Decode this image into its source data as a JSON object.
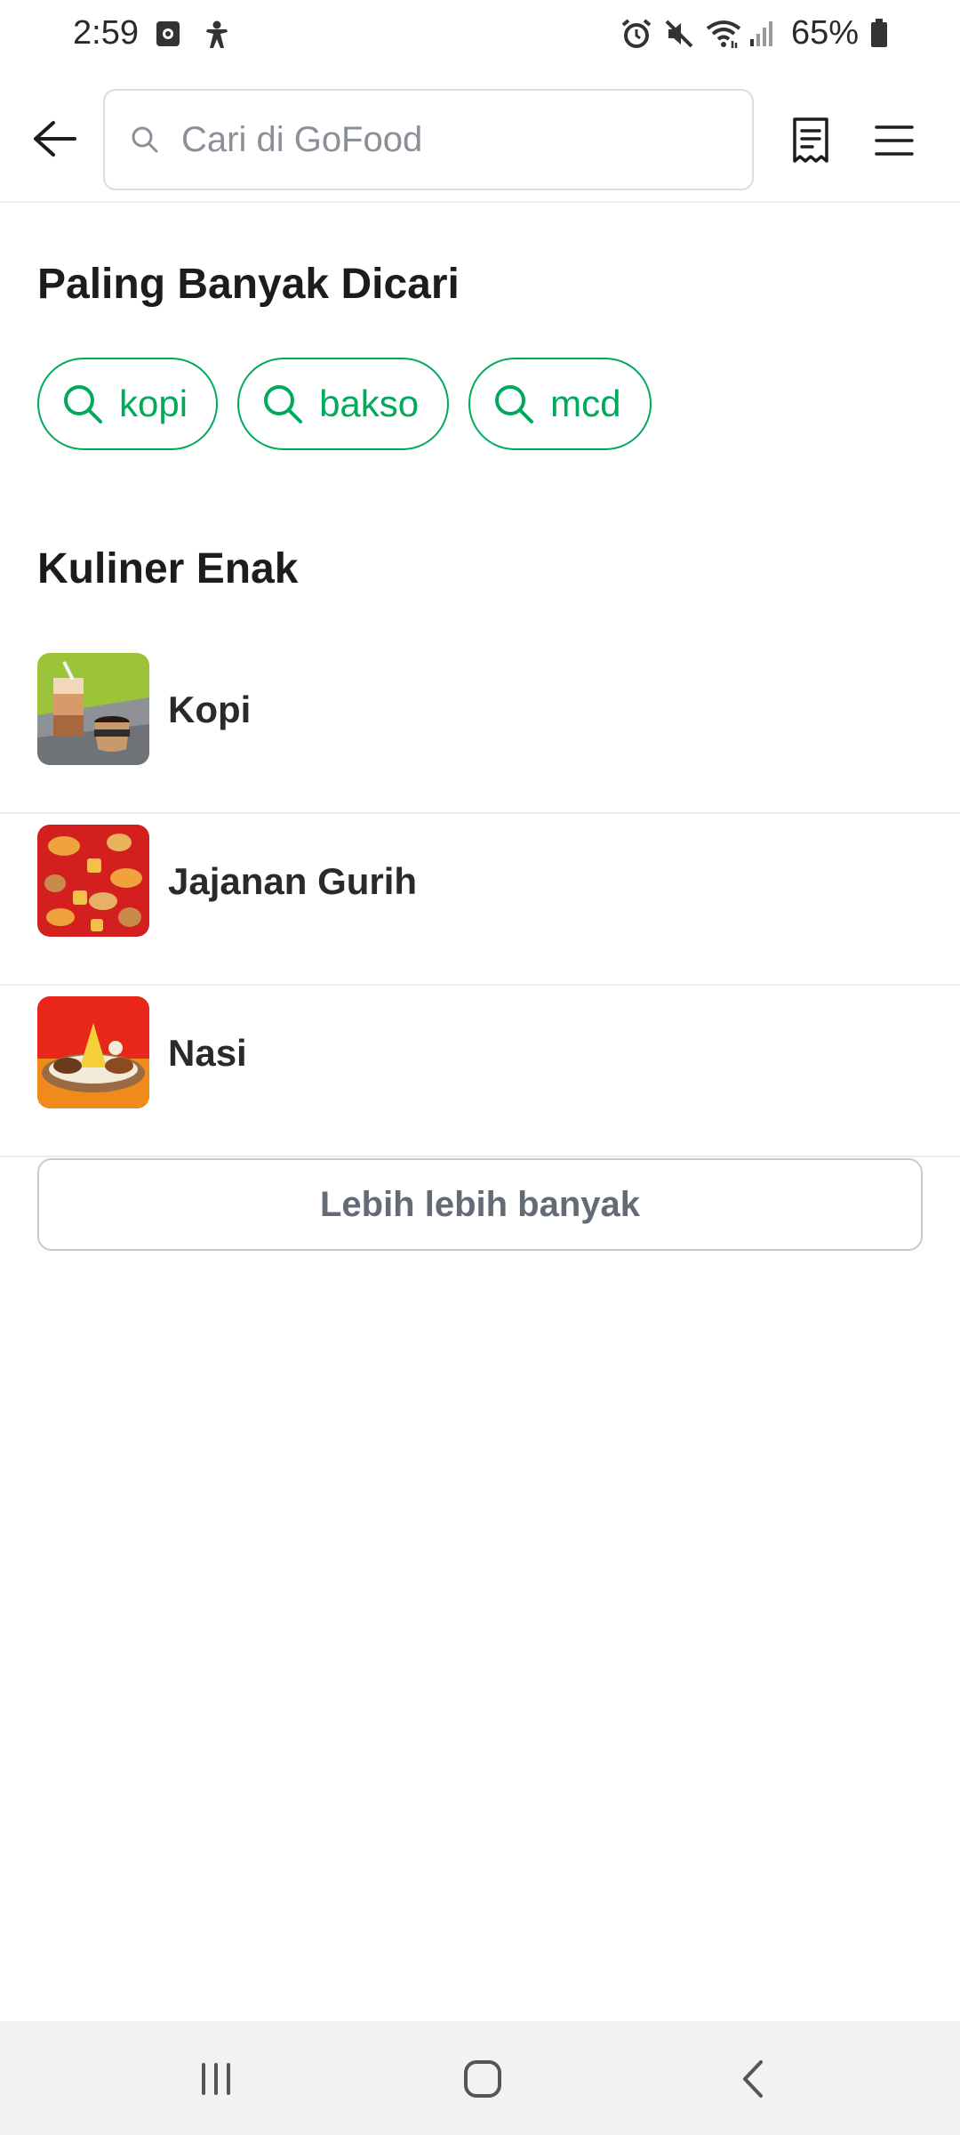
{
  "status_bar": {
    "time": "2:59",
    "battery_percent": "65%",
    "icons": [
      "screen-record-icon",
      "accessibility-icon",
      "alarm-icon",
      "mute-icon",
      "wifi-icon",
      "signal-icon",
      "battery-icon"
    ]
  },
  "header": {
    "search_placeholder": "Cari di GoFood",
    "icons": [
      "back-arrow-icon",
      "search-icon",
      "receipt-icon",
      "hamburger-menu-icon"
    ]
  },
  "popular": {
    "title": "Paling Banyak Dicari",
    "chips": [
      {
        "label": "kopi"
      },
      {
        "label": "bakso"
      },
      {
        "label": "mcd"
      }
    ]
  },
  "culinary": {
    "title": "Kuliner Enak",
    "items": [
      {
        "label": "Kopi"
      },
      {
        "label": "Jajanan Gurih"
      },
      {
        "label": "Nasi"
      }
    ],
    "more_label": "Lebih lebih banyak"
  },
  "colors": {
    "accent": "#00AA5B",
    "text": "#1C1C1C",
    "muted": "#646B76",
    "divider": "#ECECEC"
  },
  "nav": {
    "icons": [
      "recent-apps-icon",
      "home-icon",
      "system-back-icon"
    ]
  }
}
